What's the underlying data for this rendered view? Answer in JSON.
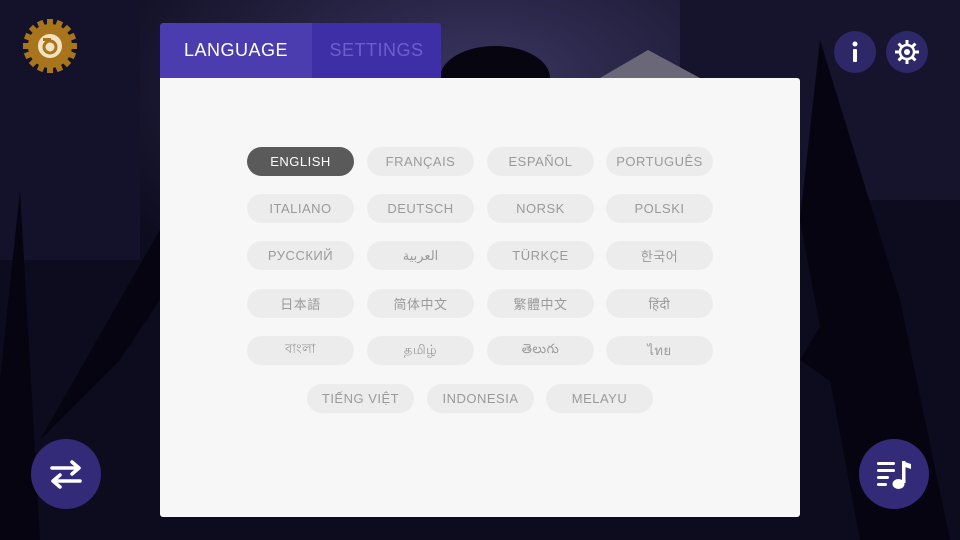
{
  "tabs": {
    "language": "LANGUAGE",
    "settings": "SETTINGS"
  },
  "languages": [
    "ENGLISH",
    "FRANÇAIS",
    "ESPAÑOL",
    "PORTUGUÊS",
    "ITALIANO",
    "DEUTSCH",
    "NORSK",
    "POLSKI",
    "РУССКИЙ",
    "العربية",
    "TÜRKÇE",
    "한국어",
    "日本語",
    "简体中文",
    "繁體中文",
    "हिंदी",
    "বাংলা",
    "தமிழ்",
    "తెలుగు",
    "ไทย",
    "TIẾNG VIỆT",
    "INDONESIA",
    "MELAYU"
  ],
  "selected_language": "ENGLISH",
  "colors": {
    "accent": "#4b3db0",
    "settings_tab": "#3e2fa6",
    "round_button": "#332a78",
    "selected_pill": "#5a5a5a",
    "pill": "#ececec",
    "panel": "#f7f7f7",
    "logo_gold": "#a8751d"
  },
  "icons": {
    "top_left": "gear-logo-icon",
    "info": "info-icon",
    "settings": "gear-icon",
    "swap": "swap-arrows-icon",
    "playlist": "playlist-music-icon"
  }
}
